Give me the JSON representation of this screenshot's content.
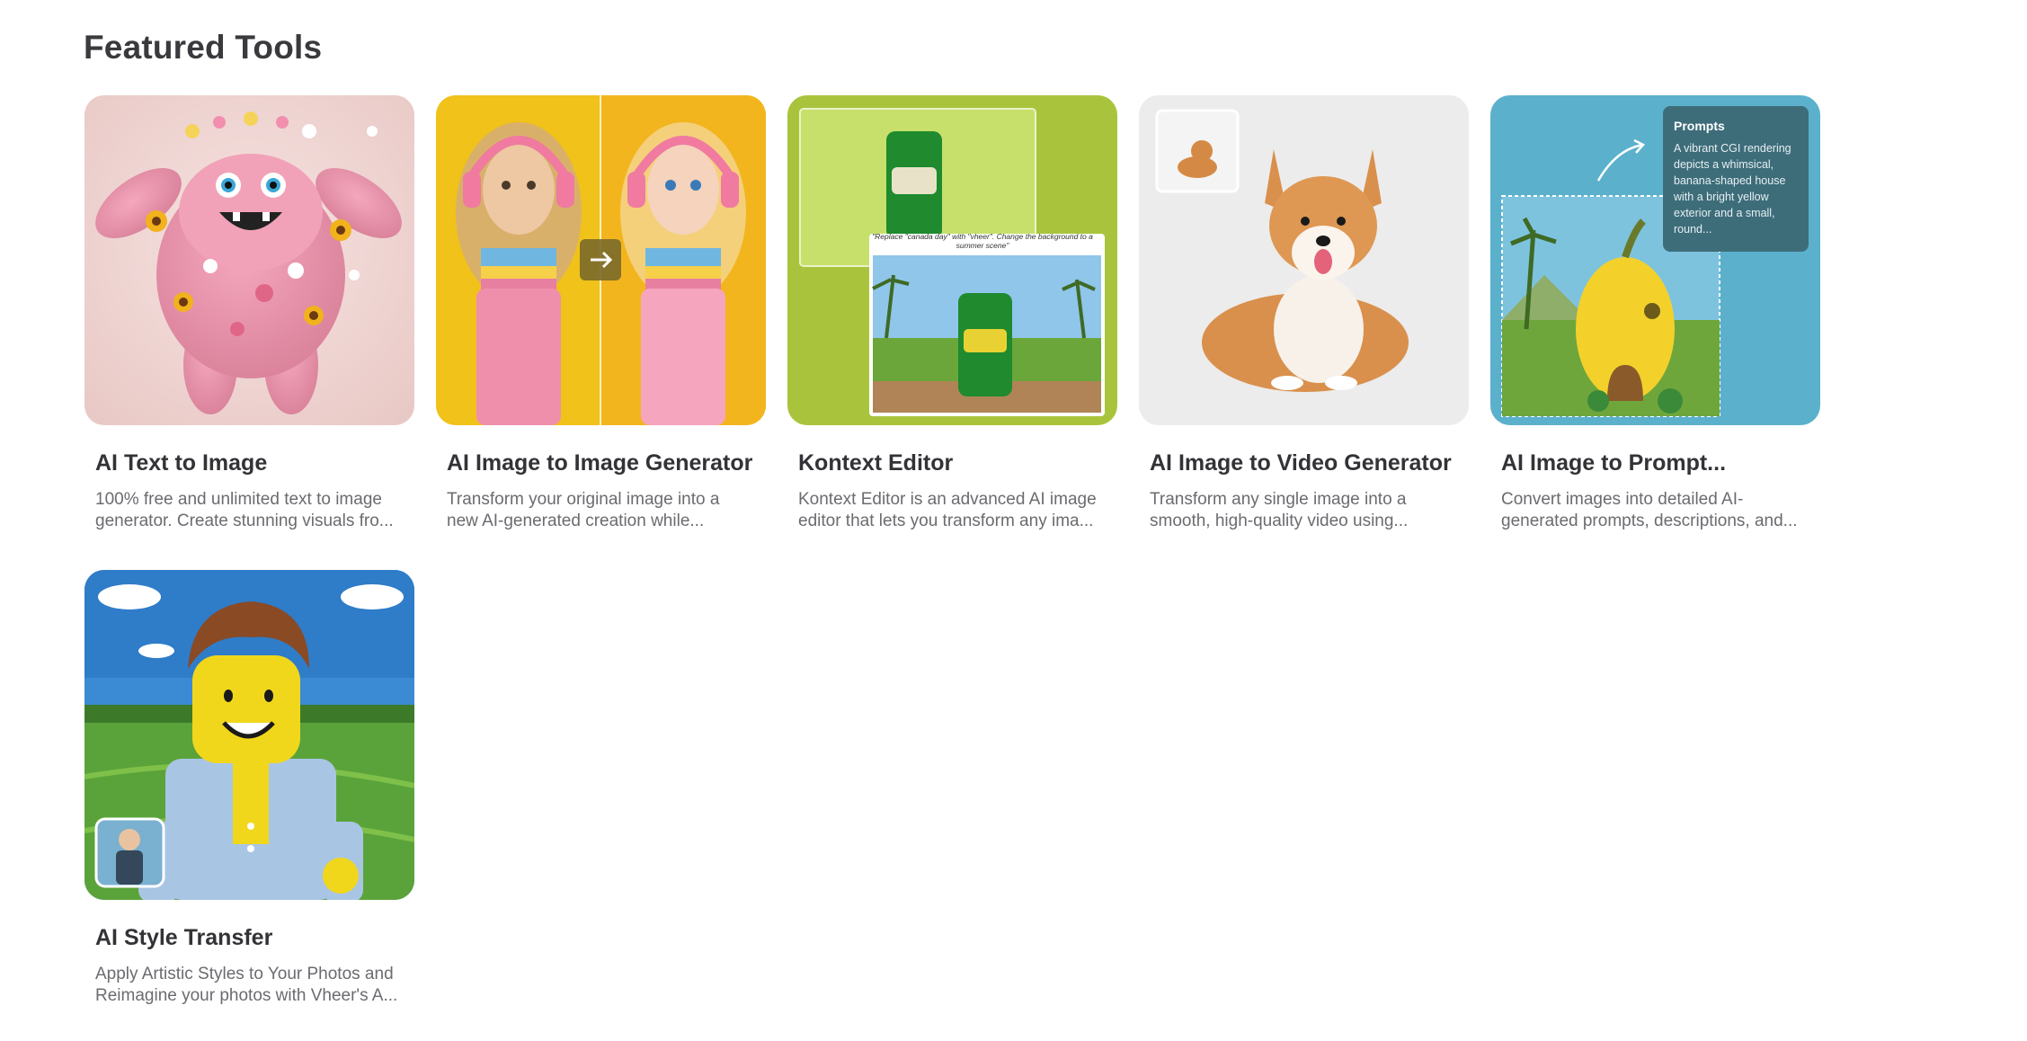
{
  "section": {
    "title": "Featured Tools"
  },
  "cards": [
    {
      "title": "AI Text to Image",
      "description": "100% free and unlimited text to image generator. Create stunning visuals fro..."
    },
    {
      "title": "AI Image to Image Generator",
      "description": "Transform your original image into a new AI-generated creation while..."
    },
    {
      "title": "Kontext Editor",
      "description": "Kontext Editor is an advanced AI image editor that lets you transform any ima...",
      "caption": "\"Replace \"canada day\" with \"vheer\". Change the background to a summer scene\""
    },
    {
      "title": "AI Image to Video Generator",
      "description": "Transform any single image into a smooth, high-quality video using..."
    },
    {
      "title": "AI Image to Prompt...",
      "description": "Convert images into detailed AI-generated prompts, descriptions, and...",
      "prompt_label": "Prompts",
      "prompt_text": "A vibrant CGI rendering depicts a whimsical, banana-shaped house with a bright yellow exterior and a small, round..."
    },
    {
      "title": "AI Style Transfer",
      "description": "Apply Artistic Styles to Your Photos and Reimagine your photos with Vheer's A..."
    }
  ],
  "colors": {
    "title": "#3a3a3e",
    "text": "#6b6b70",
    "kontext_bg": "#a9c43c",
    "prompt_bg": "#5bb1cc",
    "img2img_bg": "#f0c21a"
  }
}
